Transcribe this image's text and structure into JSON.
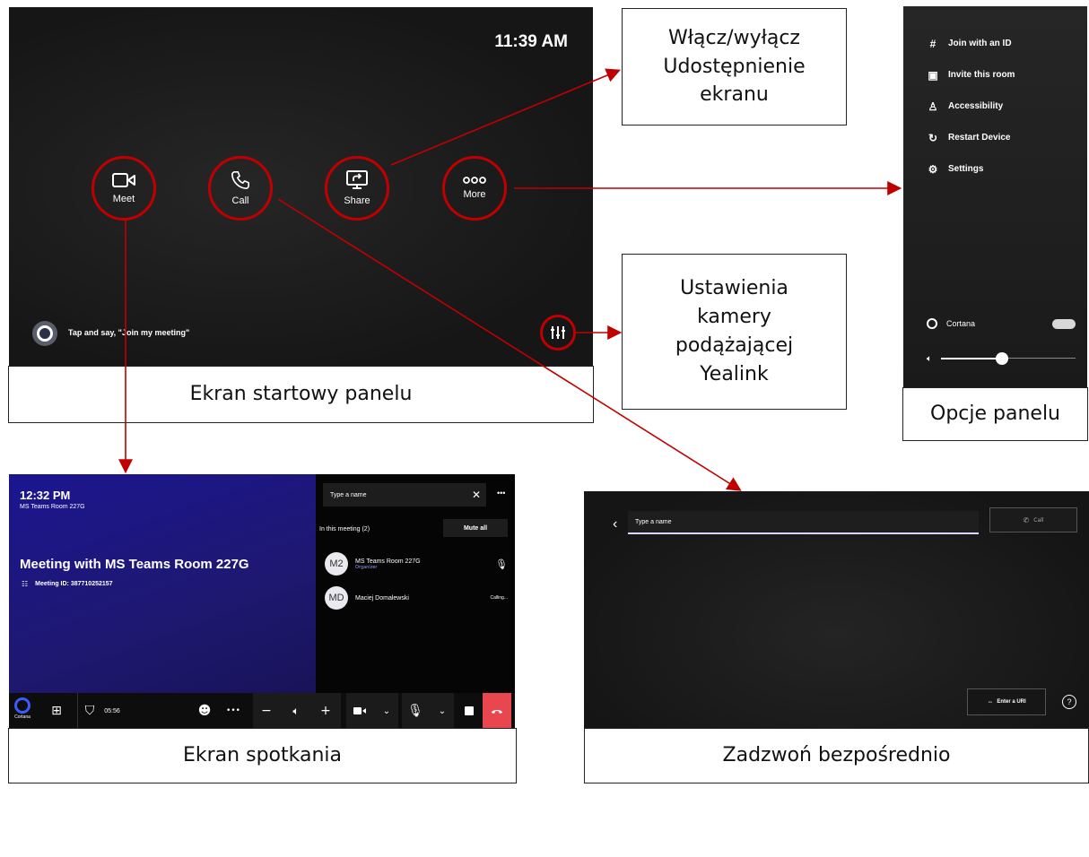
{
  "home": {
    "time": "11:39 AM",
    "buttons": [
      {
        "label": "Meet",
        "icon": "video-camera-icon"
      },
      {
        "label": "Call",
        "icon": "phone-icon"
      },
      {
        "label": "Share",
        "icon": "screen-share-icon"
      },
      {
        "label": "More",
        "icon": "more-dots-icon"
      }
    ],
    "cortana_hint": "Tap and say, \"Join my meeting\"",
    "caption": "Ekran startowy panelu"
  },
  "callouts": {
    "share": "Włącz/wyłącz Udostępnienie ekranu",
    "camera": "Ustawienia kamery podążającej Yealink"
  },
  "options": {
    "items": [
      {
        "icon": "#",
        "label": "Join with an ID"
      },
      {
        "icon": "▣",
        "label": "Invite this room"
      },
      {
        "icon": "♙",
        "label": "Accessibility"
      },
      {
        "icon": "↻",
        "label": "Restart Device"
      },
      {
        "icon": "⚙",
        "label": "Settings"
      }
    ],
    "cortana_label": "Cortana",
    "volume_level": 0.45,
    "caption": "Opcje panelu"
  },
  "meeting": {
    "time": "12:32 PM",
    "room": "MS Teams Room 227G",
    "title": "Meeting with MS Teams Room 227G",
    "meeting_id": "Meeting ID: 387710252157",
    "search_placeholder": "Type a name",
    "section_label": "In this meeting (2)",
    "mute_all": "Mute all",
    "participants": [
      {
        "initials": "M2",
        "name": "MS Teams Room 227G",
        "role": "Organizer",
        "status": ""
      },
      {
        "initials": "MD",
        "name": "Maciej Domalewski",
        "role": "",
        "status": "Calling..."
      }
    ],
    "cortana_label": "Cortana",
    "duration": "05:56",
    "caption": "Ekran spotkania"
  },
  "call": {
    "input_placeholder": "Type a name",
    "call_label": "Call",
    "enter_uri": "Enter a URI",
    "caption": "Zadzwoń bezpośrednio"
  },
  "colors": {
    "accent_red": "#c00000",
    "meeting_blue": "#1e1870",
    "hangup_red": "#e8474f"
  }
}
